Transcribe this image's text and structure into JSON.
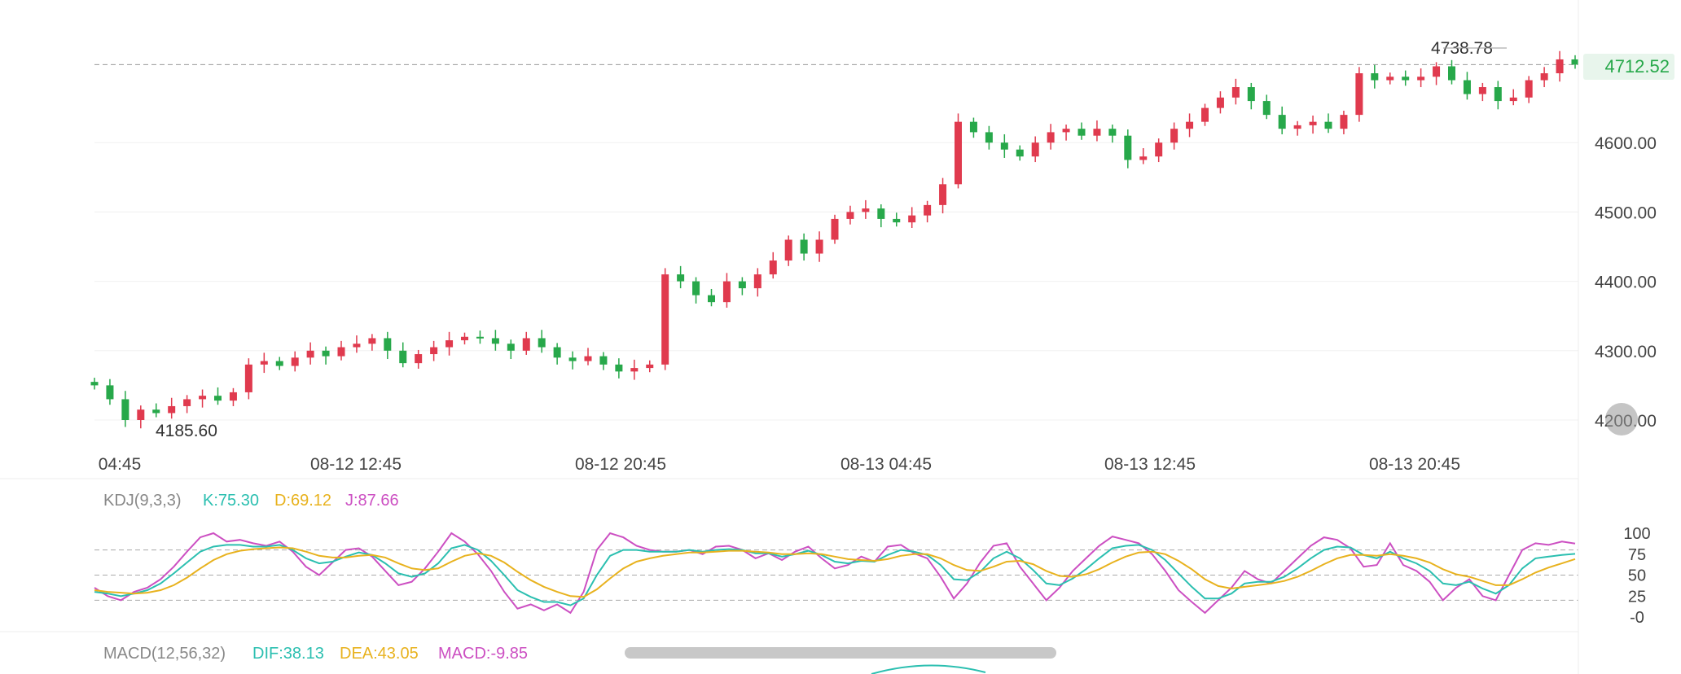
{
  "chart_data": [
    {
      "type": "candlestick",
      "price_axis": {
        "tick_labels": [
          "4600.00",
          "4500.00",
          "4400.00",
          "4300.00",
          "4200.00"
        ],
        "ticks": [
          4600,
          4500,
          4400,
          4300,
          4200
        ],
        "range": [
          4180,
          4750
        ]
      },
      "time_axis": {
        "tick_labels": [
          "04:45",
          "08-12 12:45",
          "08-12 20:45",
          "08-13 04:45",
          "08-13 12:45",
          "08-13 20:45"
        ]
      },
      "current_price": {
        "label": "4712.52",
        "value": 4712.52
      },
      "max_label": "4738.78",
      "min_label": "4185.60",
      "up_color": "#e03a4e",
      "down_color": "#27a84a",
      "closes": [
        4250,
        4230,
        4200,
        4215,
        4210,
        4220,
        4230,
        4235,
        4228,
        4240,
        4280,
        4285,
        4278,
        4290,
        4300,
        4292,
        4305,
        4310,
        4318,
        4300,
        4282,
        4295,
        4305,
        4315,
        4320,
        4318,
        4310,
        4300,
        4318,
        4305,
        4290,
        4285,
        4292,
        4280,
        4270,
        4275,
        4280,
        4410,
        4400,
        4380,
        4370,
        4400,
        4390,
        4410,
        4430,
        4460,
        4440,
        4460,
        4490,
        4500,
        4505,
        4490,
        4485,
        4495,
        4510,
        4540,
        4630,
        4615,
        4600,
        4590,
        4580,
        4600,
        4615,
        4620,
        4610,
        4620,
        4610,
        4575,
        4580,
        4600,
        4620,
        4630,
        4650,
        4665,
        4680,
        4660,
        4640,
        4620,
        4625,
        4630,
        4620,
        4640,
        4700,
        4690,
        4695,
        4690,
        4695,
        4710,
        4690,
        4670,
        4680,
        4660,
        4665,
        4690,
        4700,
        4720,
        4712.52
      ],
      "kdj": {
        "label": "KDJ(9,3,3)",
        "k_label": "K:75.30",
        "d_label": "D:69.12",
        "j_label": "J:87.66",
        "k_color": "#2bbfb0",
        "d_color": "#e8b21e",
        "j_color": "#cc4fc2",
        "tick_labels": [
          "100",
          "75",
          "50",
          "25",
          "-0"
        ],
        "ticks": [
          100,
          75,
          50,
          25,
          0
        ],
        "reference_lines": [
          80,
          50,
          20
        ],
        "j_values": [
          35,
          25,
          20,
          30,
          35,
          45,
          60,
          78,
          95,
          100,
          90,
          92,
          88,
          85,
          90,
          78,
          60,
          50,
          65,
          80,
          82,
          72,
          55,
          38,
          42,
          58,
          78,
          100,
          90,
          75,
          55,
          30,
          10,
          15,
          8,
          15,
          5,
          30,
          80,
          100,
          95,
          85,
          80,
          78,
          78,
          80,
          75,
          84,
          85,
          80,
          70,
          76,
          68,
          78,
          84,
          70,
          58,
          62,
          72,
          66,
          84,
          86,
          76,
          70,
          48,
          22,
          40,
          65,
          85,
          88,
          60,
          40,
          20,
          35,
          55,
          70,
          85,
          96,
          92,
          88,
          75,
          55,
          32,
          18,
          5,
          20,
          35,
          55,
          45,
          40,
          55,
          70,
          85,
          95,
          92,
          82,
          60,
          62,
          88,
          62,
          55,
          42,
          20,
          35,
          45,
          25,
          20,
          50,
          80,
          88,
          86,
          90,
          87.66
        ],
        "k_values": [
          30,
          28,
          25,
          28,
          32,
          40,
          52,
          65,
          78,
          84,
          86,
          86,
          84,
          84,
          86,
          80,
          70,
          64,
          66,
          72,
          77,
          74,
          64,
          52,
          48,
          52,
          64,
          82,
          86,
          80,
          67,
          50,
          32,
          24,
          18,
          18,
          14,
          22,
          50,
          73,
          80,
          80,
          78,
          78,
          78,
          80,
          78,
          80,
          81,
          80,
          76,
          76,
          72,
          75,
          79,
          74,
          66,
          64,
          67,
          66,
          74,
          80,
          78,
          74,
          62,
          45,
          44,
          54,
          70,
          78,
          70,
          56,
          40,
          38,
          46,
          57,
          70,
          82,
          85,
          86,
          80,
          68,
          52,
          36,
          22,
          22,
          28,
          40,
          42,
          42,
          48,
          58,
          70,
          80,
          84,
          83,
          74,
          70,
          78,
          70,
          64,
          55,
          40,
          38,
          42,
          34,
          28,
          38,
          58,
          70,
          72,
          74,
          75.3
        ],
        "d_values": [
          32,
          30,
          29,
          28,
          29,
          32,
          38,
          47,
          58,
          68,
          75,
          79,
          81,
          82,
          83,
          82,
          78,
          73,
          71,
          71,
          73,
          74,
          71,
          64,
          58,
          56,
          58,
          66,
          73,
          76,
          73,
          65,
          54,
          44,
          36,
          30,
          25,
          24,
          33,
          46,
          58,
          66,
          70,
          73,
          75,
          77,
          77,
          78,
          79,
          79,
          78,
          77,
          75,
          75,
          76,
          75,
          72,
          69,
          68,
          67,
          69,
          73,
          75,
          75,
          70,
          62,
          56,
          55,
          60,
          66,
          67,
          63,
          55,
          49,
          48,
          51,
          57,
          65,
          72,
          77,
          78,
          75,
          67,
          57,
          45,
          37,
          34,
          36,
          38,
          40,
          43,
          48,
          55,
          63,
          70,
          74,
          74,
          73,
          75,
          73,
          70,
          65,
          57,
          51,
          48,
          43,
          38,
          38,
          45,
          53,
          59,
          64,
          69.12
        ]
      }
    },
    {
      "type": "line",
      "macd": {
        "label": "MACD(12,56,32)",
        "dif_label": "DIF:38.13",
        "dea_label": "DEA:43.05",
        "macd_label": "MACD:-9.85",
        "dif_color": "#2bbfb0",
        "dea_color": "#e8b21e",
        "macd_color": "#cc4fc2"
      }
    }
  ]
}
